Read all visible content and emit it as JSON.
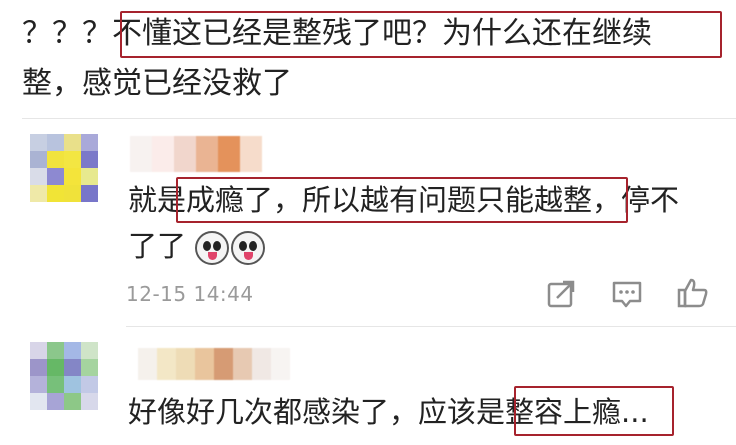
{
  "post": {
    "prefix": "？？？",
    "highlight": "不懂这已经是整残了吧？为什么还在继续",
    "line2": "整，感觉已经没救了"
  },
  "comments": [
    {
      "text_before": "就是",
      "text_highlight": "成瘾了，所以越有问题只能越整，",
      "text_after": "停不",
      "line2": "了了",
      "timestamp": "12-15 14:44",
      "emojis": [
        "husky-emoji",
        "husky-emoji"
      ]
    },
    {
      "text_before": "好像好几次都感染了，应该是",
      "text_highlight": "整容上瘾...",
      "text_after": ""
    }
  ],
  "colors": {
    "highlight_border": "#a6232d",
    "meta": "#9a9a9a"
  }
}
